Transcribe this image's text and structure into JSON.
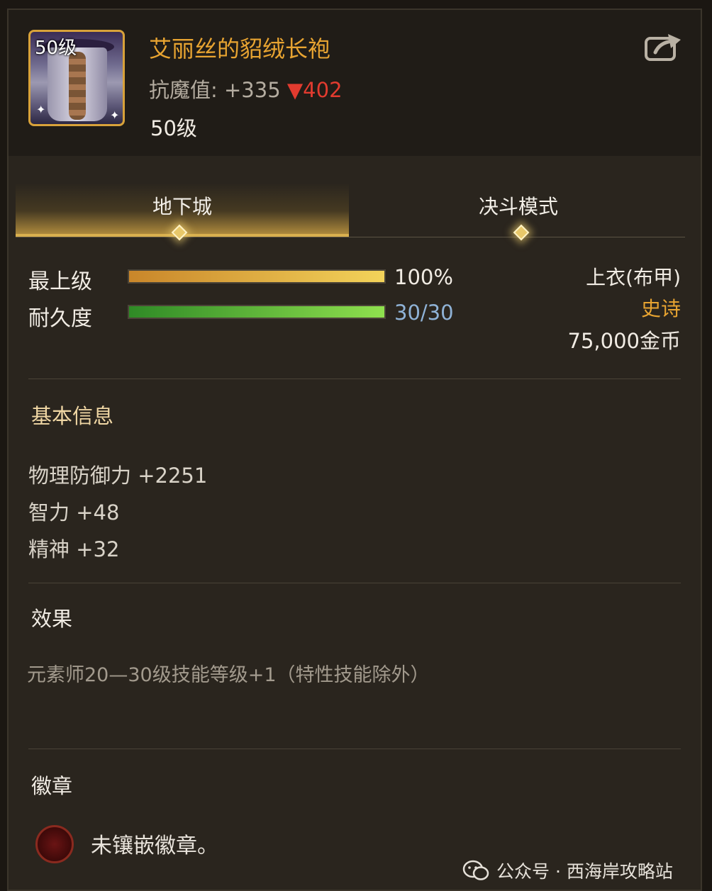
{
  "item": {
    "name": "艾丽丝的貂绒长袍",
    "icon_level_badge": "50级",
    "stat_label": "抗魔值:",
    "stat_value": "+335",
    "stat_compare": "▼402",
    "required_level": "50级"
  },
  "tabs": [
    {
      "label": "地下城",
      "active": true
    },
    {
      "label": "决斗模式",
      "active": false
    }
  ],
  "bars": {
    "grade": {
      "label": "最上级",
      "value_text": "100%",
      "fill": 1.0
    },
    "durability": {
      "label": "耐久度",
      "value_text": "30/30",
      "fill": 1.0
    }
  },
  "info": {
    "slot": "上衣(布甲)",
    "rarity": "史诗",
    "price": "75,000金币"
  },
  "basic_info": {
    "title": "基本信息",
    "attributes": [
      "物理防御力 +2251",
      "智力 +48",
      "精神 +32"
    ]
  },
  "effects": {
    "title": "效果",
    "text": "元素师20—30级技能等级+1（特性技能除外）"
  },
  "emblem": {
    "title": "徽章",
    "empty_text": "未镶嵌徽章。"
  },
  "watermark": {
    "text": "公众号 · 西海岸攻略站"
  },
  "colors": {
    "item_name": "#e8a431",
    "rarity": "#e8a431",
    "stat_down": "#e23b2f",
    "durability_value": "#8fb2d6",
    "grade_bar": "#f3d35a",
    "durability_bar": "#8fe04e"
  },
  "icons": [
    "share-icon",
    "emblem-slot-icon",
    "wechat-icon"
  ]
}
